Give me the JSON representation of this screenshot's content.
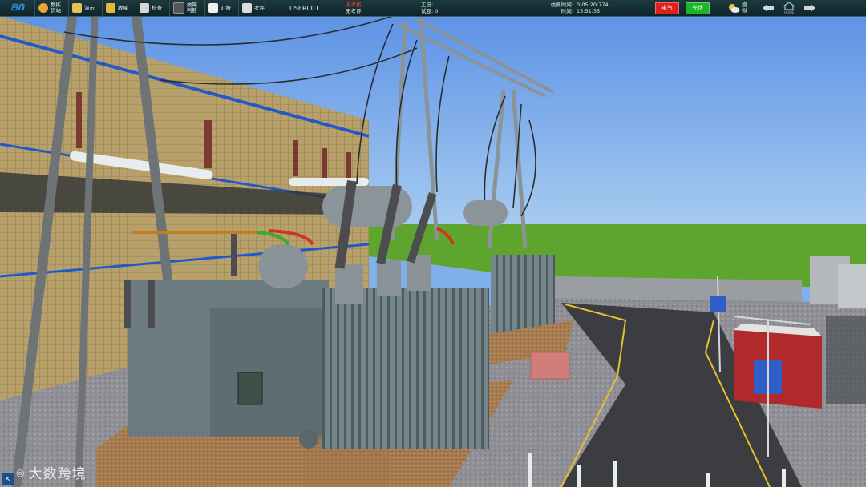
{
  "app": {
    "logo_text": "ᗷᑎ"
  },
  "toolbar": {
    "items": [
      {
        "label": "教练员站",
        "icon": "trainer-icon",
        "color": "#e9a33a"
      },
      {
        "label": "演示",
        "icon": "folder-icon",
        "color": "#e8c055"
      },
      {
        "label": "故障",
        "icon": "fault-icon",
        "color": "#e5b43d"
      },
      {
        "label": "检查",
        "icon": "check-icon",
        "color": "#d7d7d7"
      },
      {
        "label": "故障判断",
        "icon": "monitor-icon",
        "color": "#555555"
      },
      {
        "label": "汇报",
        "icon": "report-icon",
        "color": "#f0f0f0"
      },
      {
        "label": "考评",
        "icon": "exam-icon",
        "color": "#dcdcdc"
      }
    ],
    "user": "USER001",
    "status_top": "无考核",
    "status_bottom": "无考评",
    "work_label": "工况:",
    "exam_label": "试题:",
    "exam_value": "0",
    "sim_time_label": "仿真时间:",
    "sim_time_value": "0:05:20:774",
    "clock_label": "时间:",
    "clock_value": "15:51:35",
    "electric_button": "电气",
    "light_button": "光伏",
    "weather_label": "模拟",
    "home_label": "HOME"
  },
  "watermark": "大数跨境",
  "colors": {
    "sky": "#7fb0ec",
    "grass": "#5aa32c",
    "wall": "#b59e6a",
    "equipment": "#6f7f84",
    "road": "#3c3e42"
  }
}
